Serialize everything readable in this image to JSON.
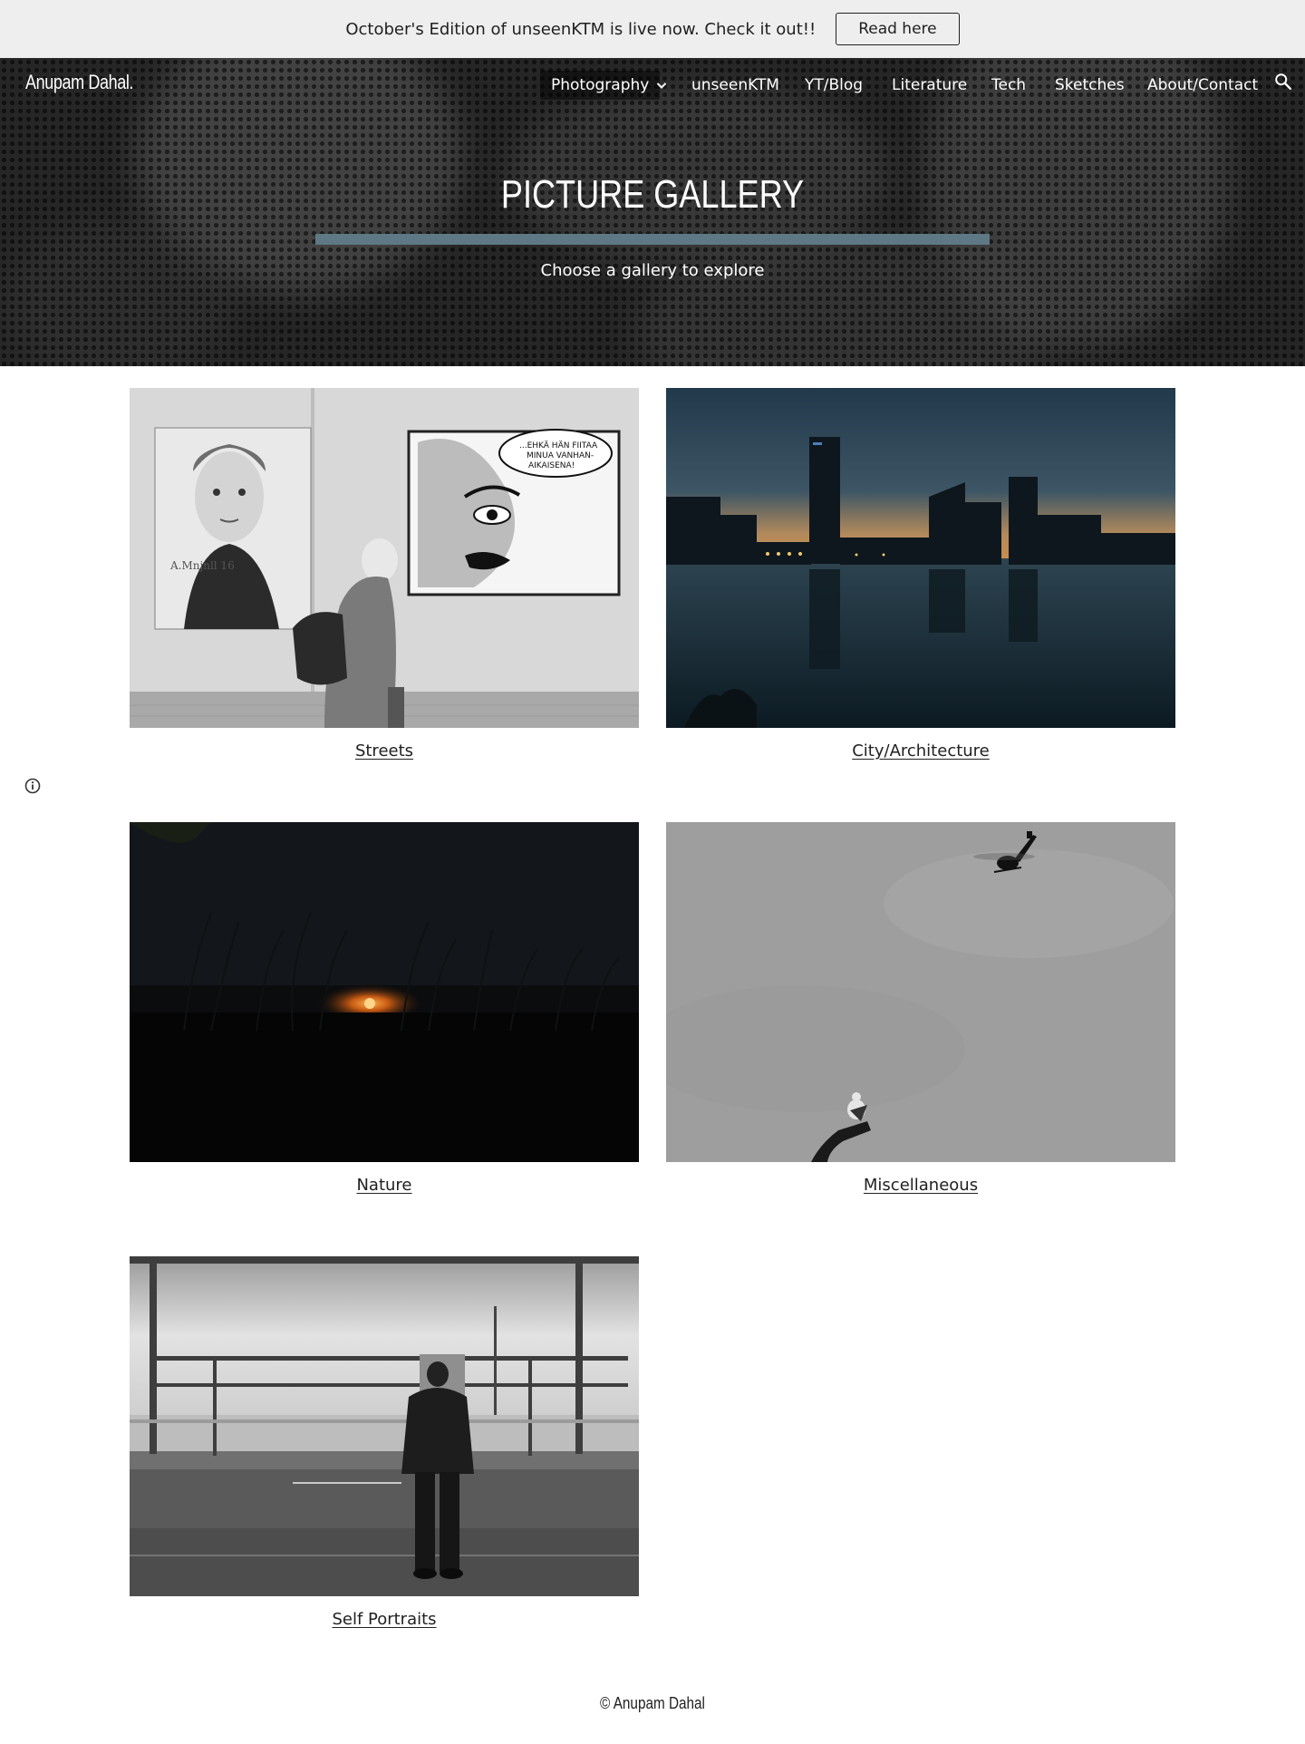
{
  "banner": {
    "text": "October's Edition of unseenKTM is live now. Check it out!!",
    "button_label": "Read here"
  },
  "site": {
    "title": "Anupam Dahal."
  },
  "nav": {
    "items": [
      {
        "label": "Photography",
        "active": true,
        "has_dropdown": true
      },
      {
        "label": "unseenKTM"
      },
      {
        "label": "YT/Blog"
      },
      {
        "label": "Literature"
      },
      {
        "label": "Tech"
      },
      {
        "label": "Sketches"
      },
      {
        "label": "About/Contact"
      }
    ],
    "search_icon": "search-icon"
  },
  "hero": {
    "title": "PICTURE GALLERY",
    "subtitle": "Choose a gallery to explore",
    "rule_color": "#5f7885"
  },
  "gallery": {
    "items": [
      {
        "caption": "Streets",
        "image": "street-photo"
      },
      {
        "caption": "City/Architecture",
        "image": "city-skyline-dusk"
      },
      {
        "caption": "Nature",
        "image": "sunset-reeds"
      },
      {
        "caption": "Miscellaneous",
        "image": "helicopter-and-gull"
      },
      {
        "caption": "Self Portraits",
        "image": "man-on-road-bw"
      }
    ]
  },
  "footer": {
    "text": "© Anupam Dahal"
  },
  "colors": {
    "banner_bg": "#eeeeee",
    "hero_bg": "#262626",
    "accent": "#5f7885"
  }
}
